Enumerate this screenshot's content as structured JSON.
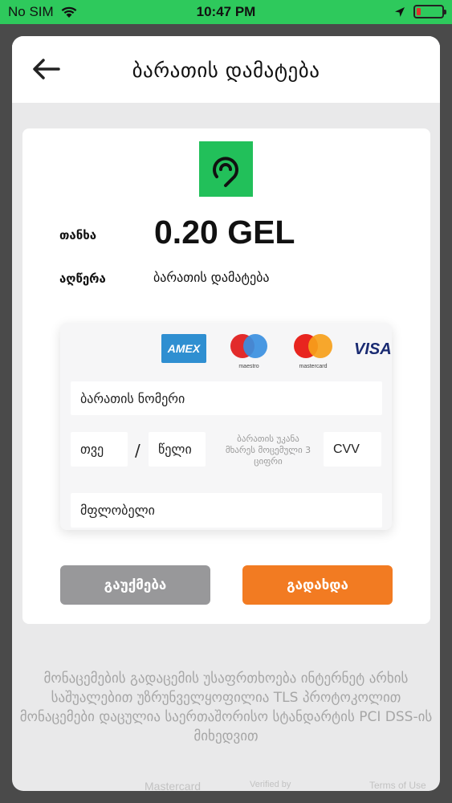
{
  "status_bar": {
    "carrier": "No SIM",
    "time": "10:47 PM"
  },
  "header": {
    "title": "ბარათის დამატება",
    "back_icon": "arrow-left-icon"
  },
  "payment": {
    "merchant_logo_icon": "location-pin-logo-icon",
    "amount_label": "თანხა",
    "amount_value": "0.20 GEL",
    "description_label": "აღწერა",
    "description_value": "ბარათის დამატება"
  },
  "card_brands": {
    "amex": "AMEX",
    "maestro_caption": "maestro",
    "mastercard_caption": "mastercard",
    "visa": "VISA"
  },
  "form": {
    "card_number_placeholder": "ბარათის ნომერი",
    "month_placeholder": "თვე",
    "separator": "/",
    "year_placeholder": "წელი",
    "cvv_hint": "ბარათის უკანა მხარეს მოცემული 3 ციფრი",
    "cvv_placeholder": "CVV",
    "holder_placeholder": "მფლობელი"
  },
  "buttons": {
    "cancel_label": "გაუქმება",
    "pay_label": "გადახდა"
  },
  "security_text": "მონაცემების გადაცემის უსაფრთხოება ინტერნეტ არხის საშუალებით უზრუნველყოფილია TLS პროტოკოლით მონაცემები დაცულია საერთაშორისო სტანდარტის PCI DSS-ის მიხედვით",
  "footer_logos": [
    "Mastercard",
    "Verified by",
    "Terms of Use"
  ],
  "colors": {
    "status_bar": "#2ec95c",
    "merchant_green": "#22c05a",
    "pay_orange": "#f27b22",
    "cancel_gray": "#98989a"
  }
}
